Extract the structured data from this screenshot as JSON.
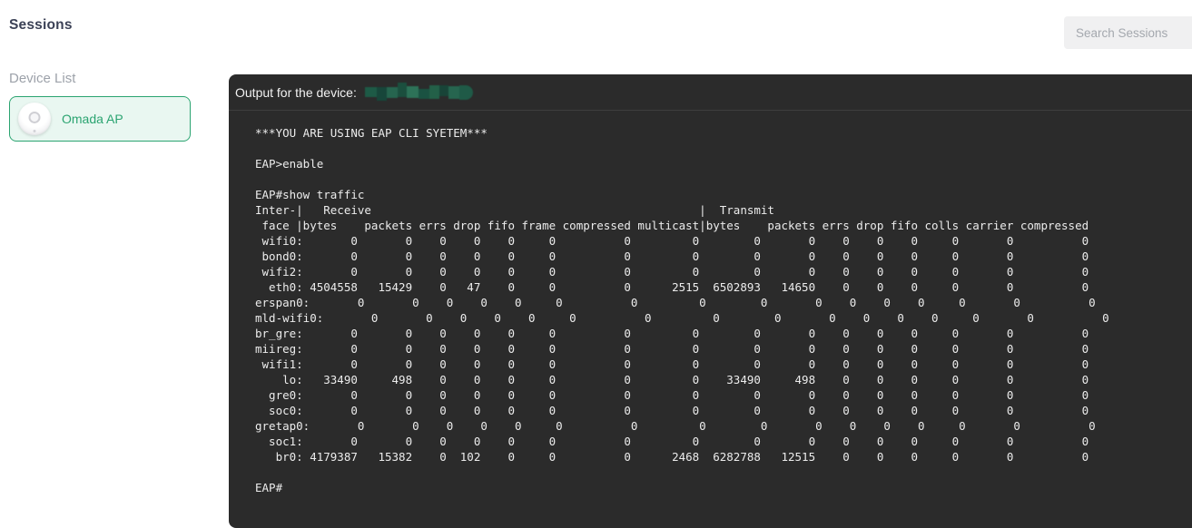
{
  "page": {
    "title": "Sessions"
  },
  "search": {
    "placeholder": "Search Sessions"
  },
  "sidebar": {
    "label": "Device List",
    "devices": [
      {
        "name": "Omada AP"
      }
    ]
  },
  "terminal": {
    "header_label": "Output for the device:",
    "device_name_redacted": true,
    "prompt_user": "EAP>",
    "prompt_enable": "EAP#",
    "lines": [
      "***YOU ARE USING EAP CLI SYETEM***",
      "",
      "EAP>enable",
      "",
      "EAP#show traffic",
      "Inter-|   Receive                                                |  Transmit",
      " face |bytes    packets errs drop fifo frame compressed multicast|bytes    packets errs drop fifo colls carrier compressed",
      " wifi0:       0       0    0    0    0     0          0         0        0       0    0    0    0     0       0          0",
      " bond0:       0       0    0    0    0     0          0         0        0       0    0    0    0     0       0          0",
      " wifi2:       0       0    0    0    0     0          0         0        0       0    0    0    0     0       0          0",
      "  eth0: 4504558   15429    0   47    0     0          0      2515  6502893   14650    0    0    0     0       0          0",
      "erspan0:       0       0    0    0    0     0          0         0        0       0    0    0    0     0       0          0",
      "mld-wifi0:       0       0    0    0    0     0          0         0        0       0    0    0    0     0       0          0",
      "br_gre:       0       0    0    0    0     0          0         0        0       0    0    0    0     0       0          0",
      "miireg:       0       0    0    0    0     0          0         0        0       0    0    0    0     0       0          0",
      " wifi1:       0       0    0    0    0     0          0         0        0       0    0    0    0     0       0          0",
      "    lo:   33490     498    0    0    0     0          0         0    33490     498    0    0    0     0       0          0",
      "  gre0:       0       0    0    0    0     0          0         0        0       0    0    0    0     0       0          0",
      "  soc0:       0       0    0    0    0     0          0         0        0       0    0    0    0     0       0          0",
      "gretap0:       0       0    0    0    0     0          0         0        0       0    0    0    0     0       0          0",
      "  soc1:       0       0    0    0    0     0          0         0        0       0    0    0    0     0       0          0",
      "   br0: 4179387   15382    0  102    0     0          0      2468  6282788   12515    0    0    0     0       0          0",
      "",
      "EAP#"
    ],
    "traffic_table": {
      "type": "table",
      "command": "show traffic",
      "rx_columns": [
        "bytes",
        "packets",
        "errs",
        "drop",
        "fifo",
        "frame",
        "compressed",
        "multicast"
      ],
      "tx_columns": [
        "bytes",
        "packets",
        "errs",
        "drop",
        "fifo",
        "colls",
        "carrier",
        "compressed"
      ],
      "interfaces": [
        {
          "iface": "wifi0",
          "rx": [
            0,
            0,
            0,
            0,
            0,
            0,
            0,
            0
          ],
          "tx": [
            0,
            0,
            0,
            0,
            0,
            0,
            0,
            0
          ]
        },
        {
          "iface": "bond0",
          "rx": [
            0,
            0,
            0,
            0,
            0,
            0,
            0,
            0
          ],
          "tx": [
            0,
            0,
            0,
            0,
            0,
            0,
            0,
            0
          ]
        },
        {
          "iface": "wifi2",
          "rx": [
            0,
            0,
            0,
            0,
            0,
            0,
            0,
            0
          ],
          "tx": [
            0,
            0,
            0,
            0,
            0,
            0,
            0,
            0
          ]
        },
        {
          "iface": "eth0",
          "rx": [
            4504558,
            15429,
            0,
            47,
            0,
            0,
            0,
            2515
          ],
          "tx": [
            6502893,
            14650,
            0,
            0,
            0,
            0,
            0,
            0
          ]
        },
        {
          "iface": "erspan0",
          "rx": [
            0,
            0,
            0,
            0,
            0,
            0,
            0,
            0
          ],
          "tx": [
            0,
            0,
            0,
            0,
            0,
            0,
            0,
            0
          ]
        },
        {
          "iface": "mld-wifi0",
          "rx": [
            0,
            0,
            0,
            0,
            0,
            0,
            0,
            0
          ],
          "tx": [
            0,
            0,
            0,
            0,
            0,
            0,
            0,
            0
          ]
        },
        {
          "iface": "br_gre",
          "rx": [
            0,
            0,
            0,
            0,
            0,
            0,
            0,
            0
          ],
          "tx": [
            0,
            0,
            0,
            0,
            0,
            0,
            0,
            0
          ]
        },
        {
          "iface": "miireg",
          "rx": [
            0,
            0,
            0,
            0,
            0,
            0,
            0,
            0
          ],
          "tx": [
            0,
            0,
            0,
            0,
            0,
            0,
            0,
            0
          ]
        },
        {
          "iface": "wifi1",
          "rx": [
            0,
            0,
            0,
            0,
            0,
            0,
            0,
            0
          ],
          "tx": [
            0,
            0,
            0,
            0,
            0,
            0,
            0,
            0
          ]
        },
        {
          "iface": "lo",
          "rx": [
            33490,
            498,
            0,
            0,
            0,
            0,
            0,
            0
          ],
          "tx": [
            33490,
            498,
            0,
            0,
            0,
            0,
            0,
            0
          ]
        },
        {
          "iface": "gre0",
          "rx": [
            0,
            0,
            0,
            0,
            0,
            0,
            0,
            0
          ],
          "tx": [
            0,
            0,
            0,
            0,
            0,
            0,
            0,
            0
          ]
        },
        {
          "iface": "soc0",
          "rx": [
            0,
            0,
            0,
            0,
            0,
            0,
            0,
            0
          ],
          "tx": [
            0,
            0,
            0,
            0,
            0,
            0,
            0,
            0
          ]
        },
        {
          "iface": "gretap0",
          "rx": [
            0,
            0,
            0,
            0,
            0,
            0,
            0,
            0
          ],
          "tx": [
            0,
            0,
            0,
            0,
            0,
            0,
            0,
            0
          ]
        },
        {
          "iface": "soc1",
          "rx": [
            0,
            0,
            0,
            0,
            0,
            0,
            0,
            0
          ],
          "tx": [
            0,
            0,
            0,
            0,
            0,
            0,
            0,
            0
          ]
        },
        {
          "iface": "br0",
          "rx": [
            4179387,
            15382,
            0,
            102,
            0,
            0,
            0,
            2468
          ],
          "tx": [
            6282788,
            12515,
            0,
            0,
            0,
            0,
            0,
            0
          ]
        }
      ]
    }
  },
  "colors": {
    "accent_green": "#2ba471",
    "device_card_bg": "#e9f7f1",
    "terminal_bg": "#2b2b2b",
    "terminal_text": "#ececec",
    "redaction_green": "#1f5a47",
    "search_bg": "#f0f0f1"
  }
}
